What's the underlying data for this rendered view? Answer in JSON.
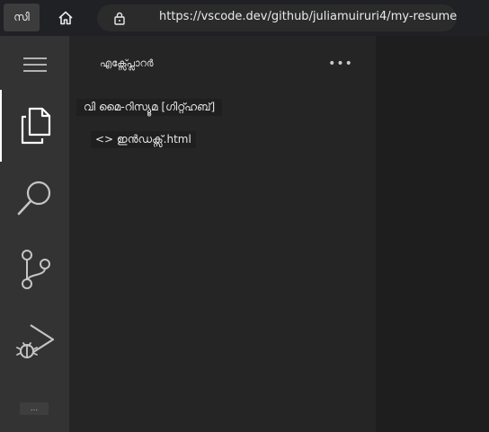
{
  "browser": {
    "profile_label": "സി",
    "url": "https://vscode.dev/github/juliamuiruri4/my-resume"
  },
  "activity_bar": {
    "accounts_label": "..."
  },
  "explorer": {
    "title": "എക്സ്പ്ലോറർ",
    "more_actions": "•••",
    "folder_label": "വി മൈ-റിസ്യൂമ [ഗിറ്റ്ഹബ്]",
    "file_label": "<> ഇൻഡക്സ്.html"
  },
  "colors": {
    "activity_bar_bg": "#333333",
    "sidebar_bg": "#252526",
    "editor_bg": "#1e1e1e",
    "icon_color": "#c5c5c5",
    "active_icon_color": "#ffffff"
  }
}
